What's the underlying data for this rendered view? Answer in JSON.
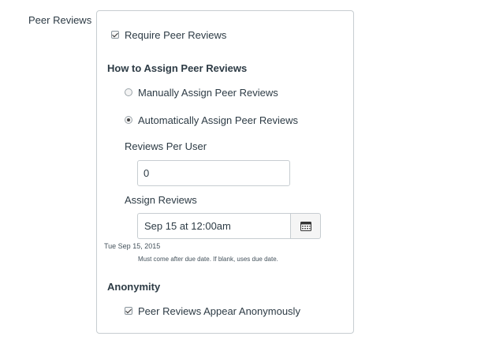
{
  "section": {
    "label": "Peer Reviews"
  },
  "require": {
    "label": "Require Peer Reviews",
    "checked": true
  },
  "assign": {
    "heading": "How to Assign Peer Reviews",
    "manual_label": "Manually Assign Peer Reviews",
    "auto_label": "Automatically Assign Peer Reviews",
    "selected": "auto"
  },
  "reviews_per_user": {
    "label": "Reviews Per User",
    "value": "0"
  },
  "assign_reviews": {
    "label": "Assign Reviews",
    "value": "Sep 15 at 12:00am",
    "calendar_icon": "calendar-icon",
    "parsed_date": "Tue Sep 15, 2015",
    "hint": "Must come after due date. If blank, uses due date."
  },
  "anonymity": {
    "heading": "Anonymity",
    "label": "Peer Reviews Appear Anonymously",
    "checked": true
  }
}
